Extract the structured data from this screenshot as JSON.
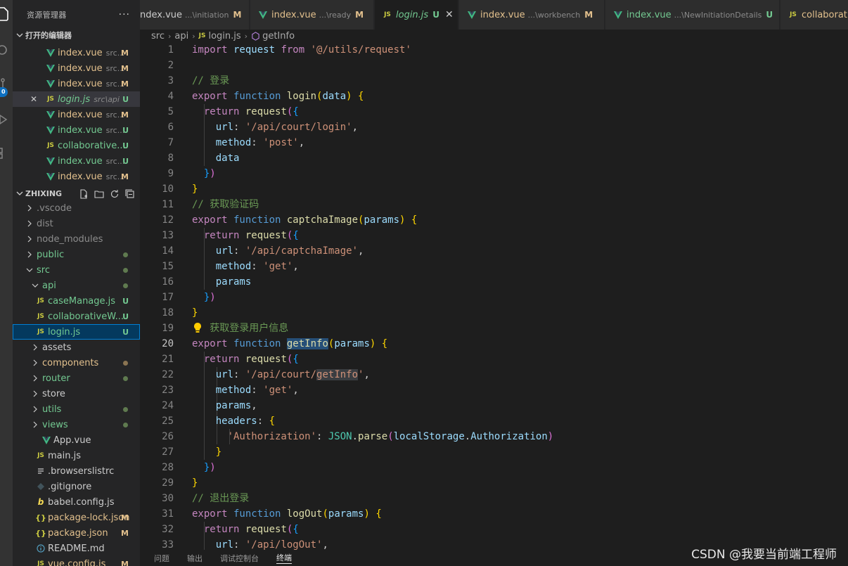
{
  "sidebar": {
    "title": "资源管理器",
    "more": "···",
    "open_editors_label": "打开的编辑器",
    "open_editors": [
      {
        "icon": "vue",
        "name": "index.vue",
        "desc": "src...",
        "status": "M",
        "close": ""
      },
      {
        "icon": "vue",
        "name": "index.vue",
        "desc": "src...",
        "status": "M",
        "close": ""
      },
      {
        "icon": "vue",
        "name": "index.vue",
        "desc": "src...",
        "status": "M",
        "close": ""
      },
      {
        "icon": "js",
        "name": "login.js",
        "desc": "src\\api",
        "status": "U",
        "close": "✕"
      },
      {
        "icon": "vue",
        "name": "index.vue",
        "desc": "src...",
        "status": "M",
        "close": ""
      },
      {
        "icon": "vue",
        "name": "index.vue",
        "desc": "src...",
        "status": "U",
        "close": ""
      },
      {
        "icon": "js",
        "name": "collaborative...",
        "desc": "",
        "status": "U",
        "close": ""
      },
      {
        "icon": "vue",
        "name": "index.vue",
        "desc": "src...",
        "status": "U",
        "close": ""
      },
      {
        "icon": "vue",
        "name": "index.vue",
        "desc": "src...",
        "status": "M",
        "close": ""
      }
    ],
    "project_label": "ZHIXING",
    "tree": [
      {
        "type": "folder",
        "name": ".vscode",
        "indent": 0,
        "open": false,
        "color": "grey",
        "status": ""
      },
      {
        "type": "folder",
        "name": "dist",
        "indent": 0,
        "open": false,
        "color": "grey",
        "status": ""
      },
      {
        "type": "folder",
        "name": "node_modules",
        "indent": 0,
        "open": false,
        "color": "grey",
        "status": ""
      },
      {
        "type": "folder",
        "name": "public",
        "indent": 0,
        "open": false,
        "color": "unt",
        "status": "dot"
      },
      {
        "type": "folder",
        "name": "src",
        "indent": 0,
        "open": true,
        "color": "unt",
        "status": "dot"
      },
      {
        "type": "folder",
        "name": "api",
        "indent": 1,
        "open": true,
        "color": "unt",
        "status": "dot"
      },
      {
        "type": "js",
        "name": "caseManage.js",
        "indent": 2,
        "color": "unt",
        "status": "U"
      },
      {
        "type": "js",
        "name": "collaborativeW...",
        "indent": 2,
        "color": "unt",
        "status": "U"
      },
      {
        "type": "js",
        "name": "login.js",
        "indent": 2,
        "color": "unt",
        "status": "U",
        "selected": true
      },
      {
        "type": "folder",
        "name": "assets",
        "indent": 1,
        "open": false,
        "color": "def",
        "status": ""
      },
      {
        "type": "folder",
        "name": "components",
        "indent": 1,
        "open": false,
        "color": "mod",
        "status": "dotm"
      },
      {
        "type": "folder",
        "name": "router",
        "indent": 1,
        "open": false,
        "color": "unt",
        "status": "dot"
      },
      {
        "type": "folder",
        "name": "store",
        "indent": 1,
        "open": false,
        "color": "def",
        "status": ""
      },
      {
        "type": "folder",
        "name": "utils",
        "indent": 1,
        "open": false,
        "color": "unt",
        "status": "dot"
      },
      {
        "type": "folder",
        "name": "views",
        "indent": 1,
        "open": false,
        "color": "unt",
        "status": "dot"
      },
      {
        "type": "vue",
        "name": "App.vue",
        "indent": 1,
        "color": "def",
        "status": ""
      },
      {
        "type": "js",
        "name": "main.js",
        "indent": 1,
        "color": "def",
        "status": ""
      },
      {
        "type": "list",
        "name": ".browserslistrc",
        "indent": 0,
        "color": "def",
        "status": ""
      },
      {
        "type": "git",
        "name": ".gitignore",
        "indent": 0,
        "color": "def",
        "status": ""
      },
      {
        "type": "babel",
        "name": "babel.config.js",
        "indent": 0,
        "color": "def",
        "status": ""
      },
      {
        "type": "json",
        "name": "package-lock.json",
        "indent": 0,
        "color": "mod",
        "status": "M"
      },
      {
        "type": "json",
        "name": "package.json",
        "indent": 0,
        "color": "mod",
        "status": "M"
      },
      {
        "type": "info",
        "name": "README.md",
        "indent": 0,
        "color": "def",
        "status": ""
      },
      {
        "type": "js",
        "name": "vue.config.js",
        "indent": 0,
        "color": "mod",
        "status": "M"
      }
    ]
  },
  "activity": {
    "badge": "0"
  },
  "tabs": [
    {
      "icon": "",
      "name": "ndex.vue",
      "desc": "...\\initiation",
      "badge": "M",
      "active": false
    },
    {
      "icon": "vue",
      "name": "index.vue",
      "desc": "...\\ready",
      "badge": "M",
      "active": false
    },
    {
      "icon": "js",
      "name": "login.js",
      "desc": "",
      "badge": "U",
      "active": true
    },
    {
      "icon": "vue",
      "name": "index.vue",
      "desc": "...\\workbench",
      "badge": "M",
      "active": false
    },
    {
      "icon": "vue",
      "name": "index.vue",
      "desc": "...\\NewInitiationDetails",
      "badge": "U",
      "active": false
    },
    {
      "icon": "js",
      "name": "collaborativ",
      "desc": "",
      "badge": "",
      "active": false
    }
  ],
  "breadcrumb": {
    "p1": "src",
    "p2": "api",
    "p3": "login.js",
    "p4": "getInfo"
  },
  "code_lines": [
    [
      [
        "kc",
        "import"
      ],
      [
        "",
        ""
      ],
      [
        "vr",
        " request"
      ],
      [
        "kc",
        " from"
      ],
      [
        "st",
        " '@/utils/request'"
      ]
    ],
    [],
    [
      [
        "cm",
        "// 登录"
      ]
    ],
    [
      [
        "kc",
        "export"
      ],
      [
        "kw",
        " function"
      ],
      [
        "fn",
        " login"
      ],
      [
        "p1",
        "("
      ],
      [
        "vr",
        "data"
      ],
      [
        "p1",
        ")"
      ],
      [
        "",
        " "
      ],
      [
        "p1",
        "{"
      ]
    ],
    [
      [
        "",
        ""
      ],
      [
        "kc",
        "  return"
      ],
      [
        "fn",
        " request"
      ],
      [
        "p2",
        "("
      ],
      [
        "p3",
        "{"
      ]
    ],
    [
      [
        "vr",
        "    url"
      ],
      [
        "",
        ": "
      ],
      [
        "st",
        "'/api/court/login'"
      ],
      [
        "",
        ","
      ]
    ],
    [
      [
        "vr",
        "    method"
      ],
      [
        "",
        ": "
      ],
      [
        "st",
        "'post'"
      ],
      [
        "",
        ","
      ]
    ],
    [
      [
        "vr",
        "    data"
      ]
    ],
    [
      [
        "p3",
        "  }"
      ],
      [
        "p2",
        ")"
      ]
    ],
    [
      [
        "p1",
        "}"
      ]
    ],
    [
      [
        "cm",
        "// 获取验证码"
      ]
    ],
    [
      [
        "kc",
        "export"
      ],
      [
        "kw",
        " function"
      ],
      [
        "fn",
        " captchaImage"
      ],
      [
        "p1",
        "("
      ],
      [
        "vr",
        "params"
      ],
      [
        "p1",
        ")"
      ],
      [
        "",
        " "
      ],
      [
        "p1",
        "{"
      ]
    ],
    [
      [
        "kc",
        "  return"
      ],
      [
        "fn",
        " request"
      ],
      [
        "p2",
        "("
      ],
      [
        "p3",
        "{"
      ]
    ],
    [
      [
        "vr",
        "    url"
      ],
      [
        "",
        ": "
      ],
      [
        "st",
        "'/api/captchaImage'"
      ],
      [
        "",
        ","
      ]
    ],
    [
      [
        "vr",
        "    method"
      ],
      [
        "",
        ": "
      ],
      [
        "st",
        "'get'"
      ],
      [
        "",
        ","
      ]
    ],
    [
      [
        "vr",
        "    params"
      ]
    ],
    [
      [
        "p3",
        "  }"
      ],
      [
        "p2",
        ")"
      ]
    ],
    [
      [
        "p1",
        "}"
      ]
    ],
    [
      [
        "cm",
        "   获取登录用户信息"
      ]
    ],
    [
      [
        "kc",
        "export"
      ],
      [
        "kw",
        " function"
      ],
      [
        "",
        " "
      ],
      [
        "fnh",
        "getInfo"
      ],
      [
        "p1",
        "("
      ],
      [
        "vr",
        "params"
      ],
      [
        "p1",
        ")"
      ],
      [
        "",
        " "
      ],
      [
        "p1",
        "{"
      ]
    ],
    [
      [
        "kc",
        "  return"
      ],
      [
        "fn",
        " request"
      ],
      [
        "p2",
        "("
      ],
      [
        "p3",
        "{"
      ]
    ],
    [
      [
        "vr",
        "    url"
      ],
      [
        "",
        ": "
      ],
      [
        "st",
        "'/api/court/"
      ],
      [
        "stw",
        "getInfo"
      ],
      [
        "st",
        "'"
      ],
      [
        "",
        ","
      ]
    ],
    [
      [
        "vr",
        "    method"
      ],
      [
        "",
        ": "
      ],
      [
        "st",
        "'get'"
      ],
      [
        "",
        ","
      ]
    ],
    [
      [
        "vr",
        "    params"
      ],
      [
        "",
        ","
      ]
    ],
    [
      [
        "vr",
        "    headers"
      ],
      [
        "",
        ": "
      ],
      [
        "p1",
        "{"
      ]
    ],
    [
      [
        "st",
        "      'Authorization'"
      ],
      [
        "",
        ": "
      ],
      [
        "cl",
        "JSON"
      ],
      [
        "",
        ".",
        ""
      ],
      [
        "fn",
        "parse"
      ],
      [
        "p2",
        "("
      ],
      [
        "vr",
        "localStorage"
      ],
      [
        "",
        "."
      ],
      [
        "vr",
        "Authorization"
      ],
      [
        "p2",
        ")"
      ]
    ],
    [
      [
        "p1",
        "    }"
      ]
    ],
    [
      [
        "p3",
        "  }"
      ],
      [
        "p2",
        ")"
      ]
    ],
    [
      [
        "p1",
        "}"
      ]
    ],
    [
      [
        "cm",
        "// 退出登录"
      ]
    ],
    [
      [
        "kc",
        "export"
      ],
      [
        "kw",
        " function"
      ],
      [
        "fn",
        " logOut"
      ],
      [
        "p1",
        "("
      ],
      [
        "vr",
        "params"
      ],
      [
        "p1",
        ")"
      ],
      [
        "",
        " "
      ],
      [
        "p1",
        "{"
      ]
    ],
    [
      [
        "kc",
        "  return"
      ],
      [
        "fn",
        " request"
      ],
      [
        "p2",
        "("
      ],
      [
        "p3",
        "{"
      ]
    ],
    [
      [
        "vr",
        "    url"
      ],
      [
        "",
        ": "
      ],
      [
        "st",
        "'/api/logOut'"
      ],
      [
        "",
        ","
      ]
    ]
  ],
  "current_line": 20,
  "panel": {
    "tabs": [
      "问题",
      "输出",
      "调试控制台",
      "终端"
    ],
    "active": 3
  },
  "watermark": "CSDN @我要当前端工程师"
}
